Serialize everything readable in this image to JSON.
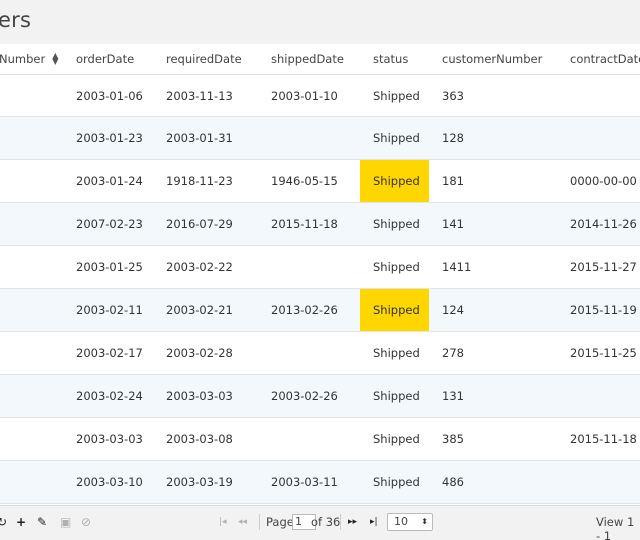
{
  "title": "ers",
  "columns": [
    "Number",
    "orderDate",
    "requiredDate",
    "shippedDate",
    "status",
    "customerNumber",
    "contractDateT"
  ],
  "rows": [
    {
      "orderDate": "2003-01-06",
      "requiredDate": "2003-11-13",
      "shippedDate": "2003-01-10",
      "status": "Shipped",
      "customerNumber": "363",
      "contractDate": "",
      "highlight": false
    },
    {
      "orderDate": "2003-01-23",
      "requiredDate": "2003-01-31",
      "shippedDate": "",
      "status": "Shipped",
      "customerNumber": "128",
      "contractDate": "",
      "highlight": false
    },
    {
      "orderDate": "2003-01-24",
      "requiredDate": "1918-11-23",
      "shippedDate": "1946-05-15",
      "status": "Shipped",
      "customerNumber": "181",
      "contractDate": "0000-00-00",
      "highlight": true
    },
    {
      "orderDate": "2007-02-23",
      "requiredDate": "2016-07-29",
      "shippedDate": "2015-11-18",
      "status": "Shipped",
      "customerNumber": "141",
      "contractDate": "2014-11-26",
      "highlight": false
    },
    {
      "orderDate": "2003-01-25",
      "requiredDate": "2003-02-22",
      "shippedDate": "",
      "status": "Shipped",
      "customerNumber": "1411",
      "contractDate": "2015-11-27",
      "highlight": false
    },
    {
      "orderDate": "2003-02-11",
      "requiredDate": "2003-02-21",
      "shippedDate": "2013-02-26",
      "status": "Shipped",
      "customerNumber": "124",
      "contractDate": "2015-11-19",
      "highlight": true
    },
    {
      "orderDate": "2003-02-17",
      "requiredDate": "2003-02-28",
      "shippedDate": "",
      "status": "Shipped",
      "customerNumber": "278",
      "contractDate": "2015-11-25",
      "highlight": false
    },
    {
      "orderDate": "2003-02-24",
      "requiredDate": "2003-03-03",
      "shippedDate": "2003-02-26",
      "status": "Shipped",
      "customerNumber": "131",
      "contractDate": "",
      "highlight": false
    },
    {
      "orderDate": "2003-03-03",
      "requiredDate": "2003-03-08",
      "shippedDate": "",
      "status": "Shipped",
      "customerNumber": "385",
      "contractDate": "2015-11-18",
      "highlight": false
    },
    {
      "orderDate": "2003-03-10",
      "requiredDate": "2003-03-19",
      "shippedDate": "2003-03-11",
      "status": "Shipped",
      "customerNumber": "486",
      "contractDate": "",
      "highlight": false
    }
  ],
  "highlight_color": "#ffd600",
  "alt_row_color": "#f3f8fd",
  "footer": {
    "icons": [
      "refresh-icon",
      "add-icon",
      "edit-icon",
      "save-icon",
      "cancel-icon"
    ],
    "page_label": "Page",
    "page_value": "1",
    "of_label": "of 36",
    "page_size": "10",
    "view_text": "View 1 - 1"
  }
}
